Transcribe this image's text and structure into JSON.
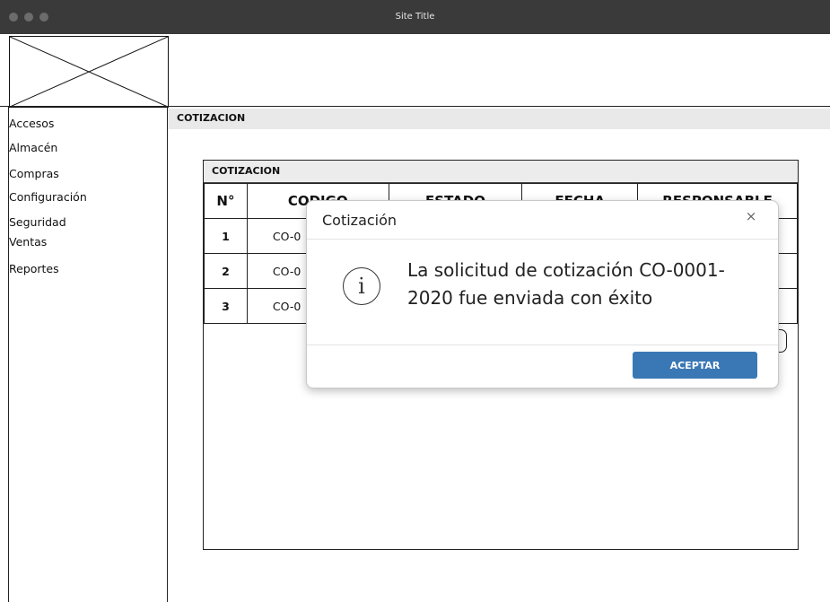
{
  "window": {
    "title": "Site Title"
  },
  "sidebar": {
    "items": [
      {
        "label": "Accesos"
      },
      {
        "label": "Almacén"
      },
      {
        "label": "Compras"
      },
      {
        "label": "Configuración"
      },
      {
        "label": "Seguridad"
      },
      {
        "label": "Ventas"
      },
      {
        "label": "Reportes"
      }
    ]
  },
  "section": {
    "title": "COTIZACION"
  },
  "panel": {
    "title": "COTIZACION",
    "columns": [
      "N°",
      "CODIGO",
      "ESTADO",
      "FECHA",
      "RESPONSABLE"
    ],
    "rows": [
      {
        "num": "1",
        "code": "CO-0"
      },
      {
        "num": "2",
        "code": "CO-0"
      },
      {
        "num": "3",
        "code": "CO-0"
      }
    ]
  },
  "modal": {
    "title": "Cotización",
    "close_icon": "×",
    "info_icon": "i",
    "message_line1": "La solicitud de cotización CO-0001-",
    "message_line2": "2020 fue enviada con éxito",
    "accept_label": "ACEPTAR",
    "accept_color": "#3a78b5"
  }
}
